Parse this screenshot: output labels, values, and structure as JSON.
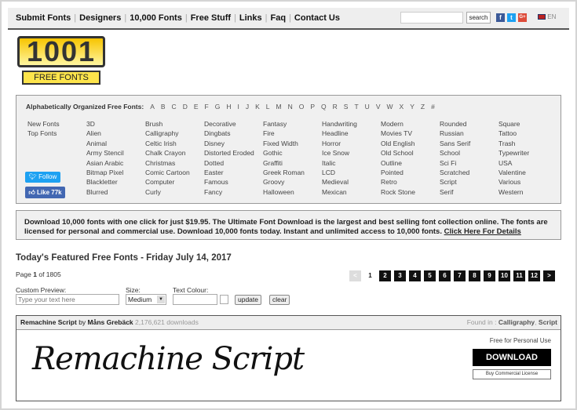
{
  "nav": {
    "links": [
      "Submit Fonts",
      "Designers",
      "10,000 Fonts",
      "Free Stuff",
      "Links",
      "Faq",
      "Contact Us"
    ],
    "search_placeholder": "",
    "search_button": "search",
    "social": [
      "f",
      "t",
      "G+"
    ],
    "lang": "EN"
  },
  "logo": {
    "number": "1001",
    "text": "FREE FONTS"
  },
  "categories": {
    "alpha_label": "Alphabetically Organized Free Fonts:",
    "letters": [
      "A",
      "B",
      "C",
      "D",
      "E",
      "F",
      "G",
      "H",
      "I",
      "J",
      "K",
      "L",
      "M",
      "N",
      "O",
      "P",
      "Q",
      "R",
      "S",
      "T",
      "U",
      "V",
      "W",
      "X",
      "Y",
      "Z",
      "#"
    ],
    "columns": [
      [
        "New Fonts",
        "Top Fonts"
      ],
      [
        "3D",
        "Alien",
        "Animal",
        "Army Stencil",
        "Asian Arabic",
        "Bitmap Pixel",
        "Blackletter",
        "Blurred"
      ],
      [
        "Brush",
        "Calligraphy",
        "Celtic Irish",
        "Chalk Crayon",
        "Christmas",
        "Comic Cartoon",
        "Computer",
        "Curly"
      ],
      [
        "Decorative",
        "Dingbats",
        "Disney",
        "Distorted Eroded",
        "Dotted",
        "Easter",
        "Famous",
        "Fancy"
      ],
      [
        "Fantasy",
        "Fire",
        "Fixed Width",
        "Gothic",
        "Graffiti",
        "Greek Roman",
        "Groovy",
        "Halloween"
      ],
      [
        "Handwriting",
        "Headline",
        "Horror",
        "Ice Snow",
        "Italic",
        "LCD",
        "Medieval",
        "Mexican"
      ],
      [
        "Modern",
        "Movies TV",
        "Old English",
        "Old School",
        "Outline",
        "Pointed",
        "Retro",
        "Rock Stone"
      ],
      [
        "Rounded",
        "Russian",
        "Sans Serif",
        "School",
        "Sci Fi",
        "Scratched",
        "Script",
        "Serif"
      ],
      [
        "Square",
        "Tattoo",
        "Trash",
        "Typewriter",
        "USA",
        "Valentine",
        "Various",
        "Western"
      ]
    ],
    "follow": "Follow",
    "like": "Like 77k"
  },
  "promo": {
    "text": "Download 10,000 fonts with one click for just $19.95. The Ultimate Font Download is the largest and best selling font collection online. The fonts are licensed for personal and commercial use. Download 10,000 fonts today. Instant and unlimited access to 10,000 fonts.",
    "link": "Click Here For Details"
  },
  "featured": {
    "title": "Today's Featured Free Fonts - Friday July 14, 2017",
    "page_label": "Page",
    "page": "1",
    "of": "of 1805",
    "pager": [
      "<",
      "1",
      "2",
      "3",
      "4",
      "5",
      "6",
      "7",
      "8",
      "9",
      "10",
      "11",
      "12",
      ">"
    ]
  },
  "preview": {
    "custom_label": "Custom Preview:",
    "placeholder": "Type your text here",
    "size_label": "Size:",
    "size_value": "Medium",
    "colour_label": "Text Colour:",
    "update": "update",
    "clear": "clear"
  },
  "font": {
    "name": "Remachine Script",
    "by": "by",
    "author": "Måns Grebäck",
    "downloads": "2,176,621 downloads",
    "found_in": "Found in :",
    "cats": [
      "Calligraphy",
      "Script"
    ],
    "preview_text": "Remachine Script",
    "license": "Free for Personal Use",
    "download": "DOWNLOAD",
    "commercial": "Buy Commercial License"
  }
}
